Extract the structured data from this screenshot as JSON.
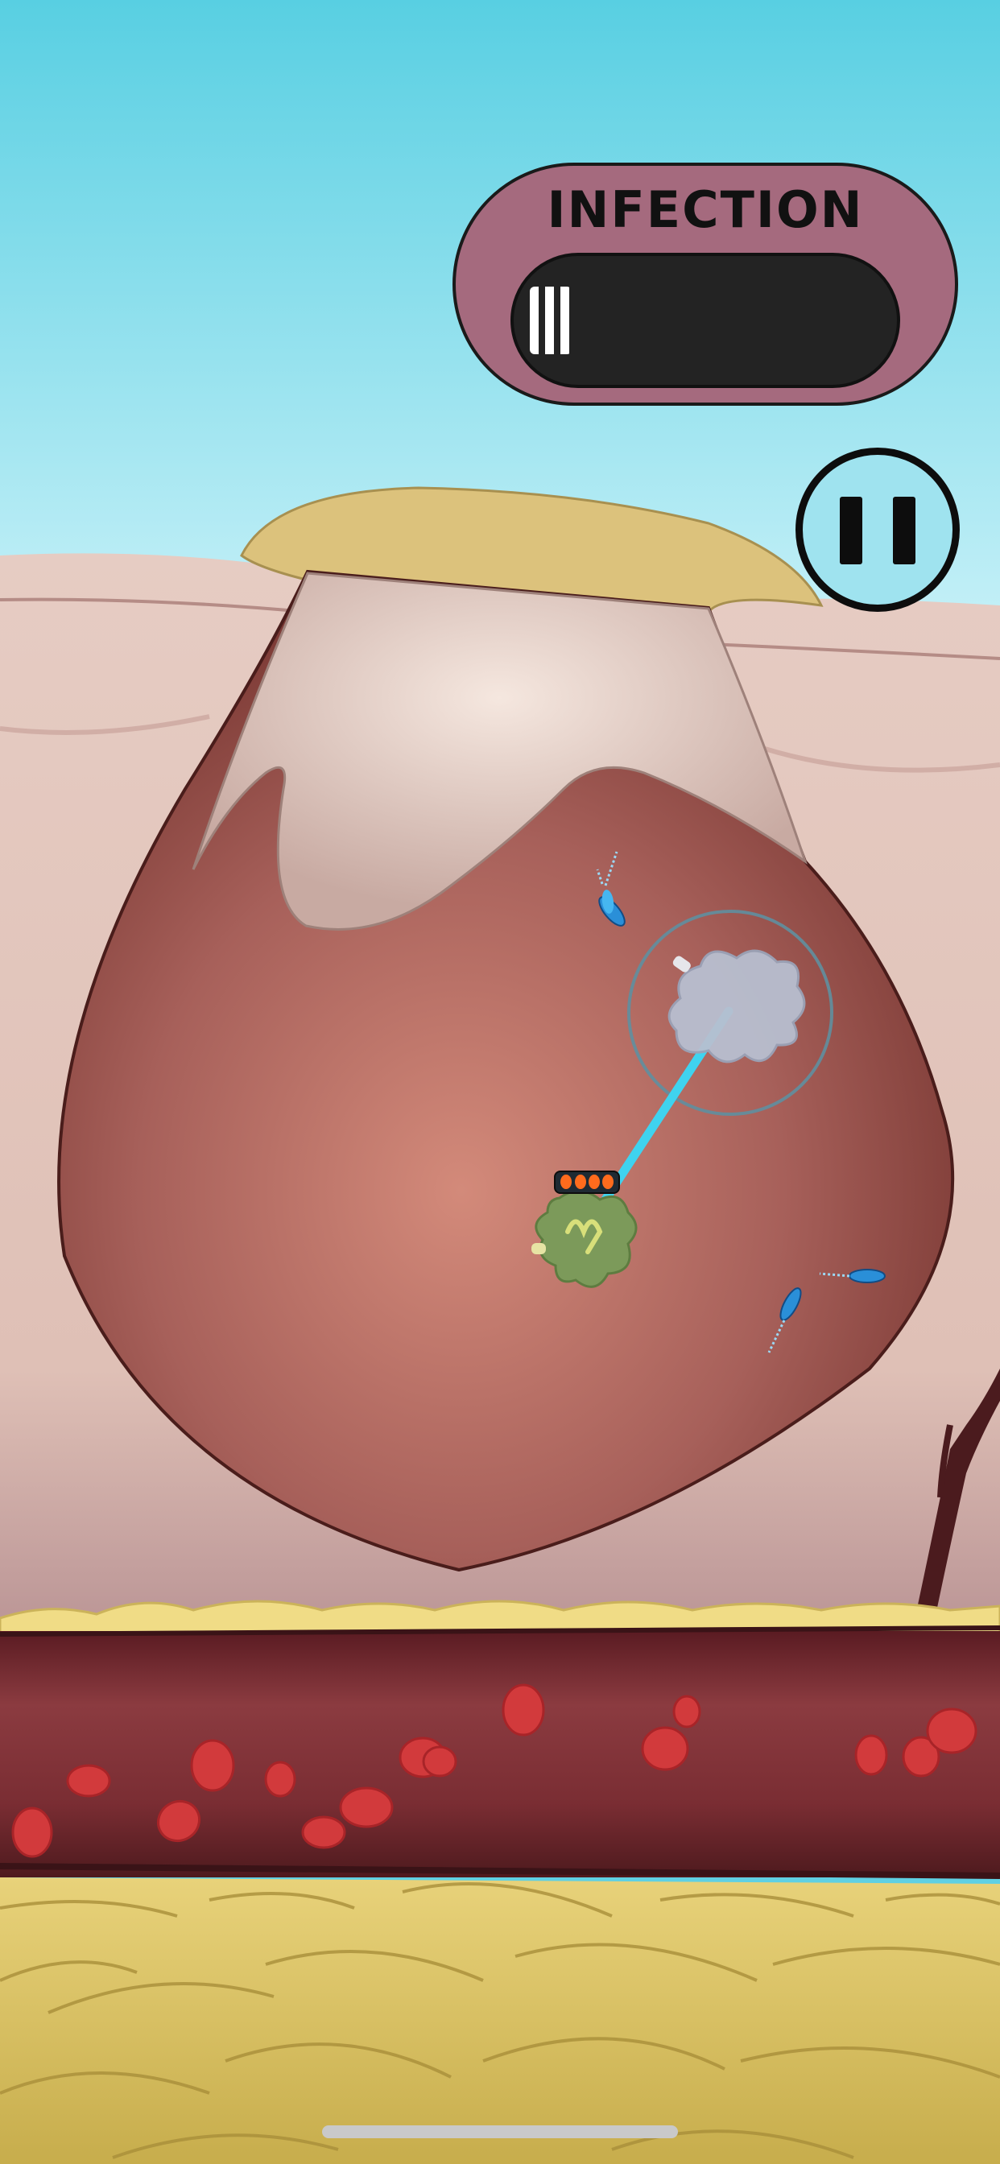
{
  "hud": {
    "infection_label": "INFECTION",
    "infection_level": 0.12
  },
  "icons": {
    "pause": "pause-icon"
  },
  "colors": {
    "sky": "#5fd0e3",
    "panel": "#a56a7e",
    "track": "#232323",
    "wound": "#a85f55",
    "skin": "#e2c4ba",
    "blood_vessel": "#7a2c31",
    "fat": "#d4bb5a",
    "laser": "#3fd3ef"
  },
  "player": {
    "health_pips": 4
  }
}
